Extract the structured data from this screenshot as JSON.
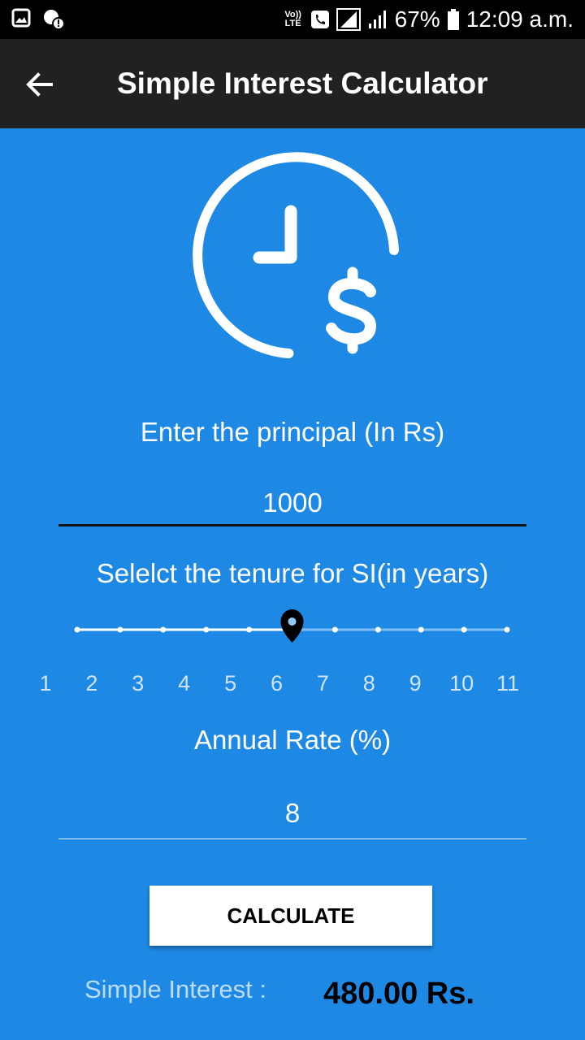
{
  "status_bar": {
    "network_label": "Vo)) LTE",
    "battery": "67%",
    "time": "12:09 a.m."
  },
  "app_bar": {
    "title": "Simple Interest Calculator"
  },
  "principal": {
    "label": "Enter the principal (In Rs)",
    "value": "1000"
  },
  "tenure": {
    "label": "Selelct the tenure for SI(in years)",
    "ticks": [
      "1",
      "2",
      "3",
      "4",
      "5",
      "6",
      "7",
      "8",
      "9",
      "10",
      "11"
    ],
    "selected_index": 5,
    "selected_fraction": 0.5
  },
  "rate": {
    "label": "Annual Rate (%)",
    "value": "8"
  },
  "calculate_button": "CALCULATE",
  "result": {
    "label": "Simple Interest :",
    "value": "480.00 Rs."
  },
  "colors": {
    "background": "#1e88e5",
    "app_bar": "#212121",
    "status_bar": "#000000",
    "slider_active": "#ffffff",
    "slider_inactive": "#7fbdf2",
    "thumb": "#000000"
  }
}
